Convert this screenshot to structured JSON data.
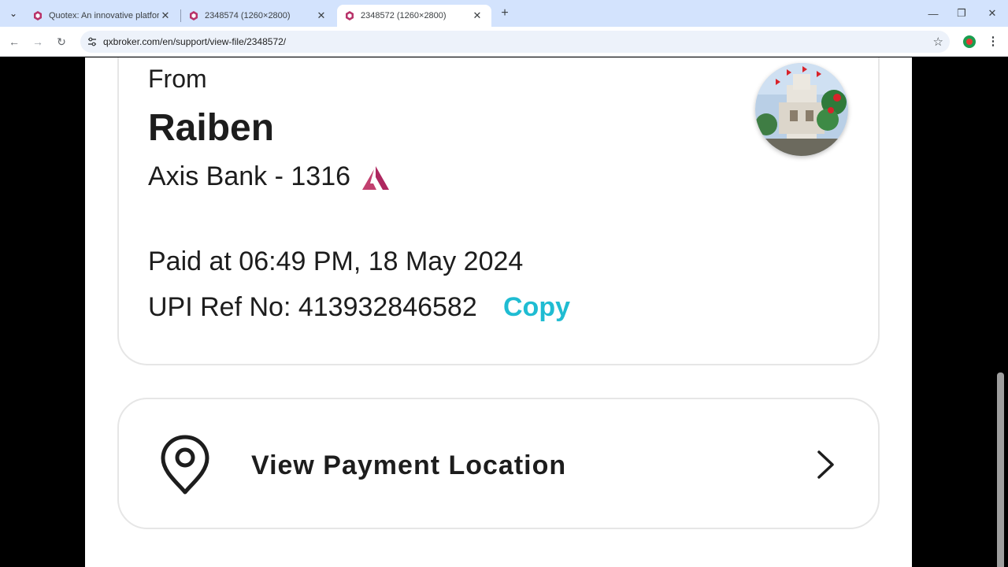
{
  "browser": {
    "tabs": [
      {
        "title": "Quotex: An innovative platform",
        "active": false
      },
      {
        "title": "2348574 (1260×2800)",
        "active": false
      },
      {
        "title": "2348572 (1260×2800)",
        "active": true
      }
    ],
    "url": "qxbroker.com/en/support/view-file/2348572/",
    "icons": [
      "tab-search-icon",
      "close-icon",
      "plus-icon",
      "minimize-icon",
      "restore-icon",
      "back-icon",
      "forward-icon",
      "reload-icon",
      "site-info-icon",
      "star-icon",
      "extension-icon",
      "menu-icon"
    ]
  },
  "receipt": {
    "from_label": "From",
    "sender_name": "Raiben",
    "bank": "Axis Bank - 1316",
    "paid_at": "Paid at 06:49 PM, 18 May 2024",
    "upi_ref": "UPI Ref No: 413932846582",
    "copy_label": "Copy",
    "copy_color": "#1fbcd2",
    "bank_logo_color": "#ae275f",
    "location_label": "View Payment Location"
  }
}
